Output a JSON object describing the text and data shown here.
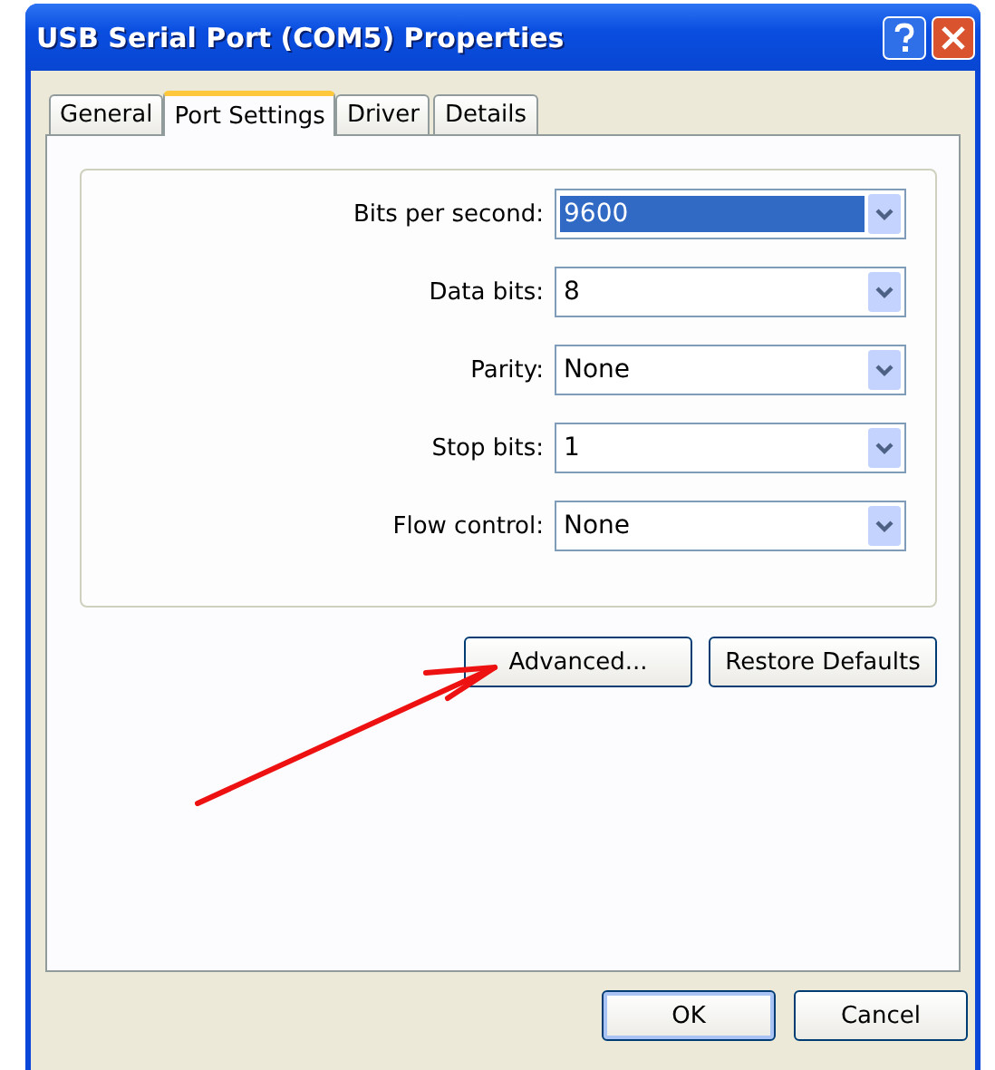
{
  "window": {
    "title": "USB Serial Port (COM5) Properties"
  },
  "tabs": [
    {
      "label": "General",
      "selected": false
    },
    {
      "label": "Port Settings",
      "selected": true
    },
    {
      "label": "Driver",
      "selected": false
    },
    {
      "label": "Details",
      "selected": false
    }
  ],
  "settings": [
    {
      "label": "Bits per second:",
      "value": "9600",
      "focused": true
    },
    {
      "label": "Data bits:",
      "value": "8",
      "focused": false
    },
    {
      "label": "Parity:",
      "value": "None",
      "focused": false
    },
    {
      "label": "Stop bits:",
      "value": "1",
      "focused": false
    },
    {
      "label": "Flow control:",
      "value": "None",
      "focused": false
    }
  ],
  "panel_buttons": [
    "Advanced...",
    "Restore Defaults"
  ],
  "buttons": [
    "OK",
    "Cancel"
  ]
}
